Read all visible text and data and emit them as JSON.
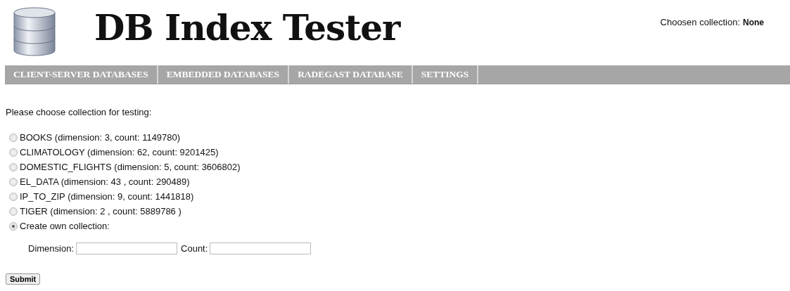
{
  "header": {
    "title": "DB Index Tester",
    "chosen_label": "Choosen collection:",
    "chosen_value": "None"
  },
  "nav": [
    {
      "label": "CLIENT-SERVER DATABASES"
    },
    {
      "label": "EMBEDDED DATABASES"
    },
    {
      "label": "RADEGAST DATABASE"
    },
    {
      "label": "SETTINGS"
    }
  ],
  "prompt": "Please choose collection for testing:",
  "options": [
    {
      "label": "BOOKS (dimension: 3, count: 1149780)",
      "selected": false
    },
    {
      "label": "CLIMATOLOGY (dimension: 62, count: 9201425)",
      "selected": false
    },
    {
      "label": "DOMESTIC_FLIGHTS (dimension: 5, count: 3606802)",
      "selected": false
    },
    {
      "label": "EL_DATA (dimension: 43 , count: 290489)",
      "selected": false
    },
    {
      "label": "IP_TO_ZIP (dimension: 9, count: 1441818)",
      "selected": false
    },
    {
      "label": "TIGER (dimension: 2 , count: 5889786 )",
      "selected": false
    },
    {
      "label": "Create own collection:",
      "selected": true
    }
  ],
  "fields": [
    {
      "label": "Dimension:"
    },
    {
      "label": "Count:"
    }
  ],
  "submit": "Submit"
}
